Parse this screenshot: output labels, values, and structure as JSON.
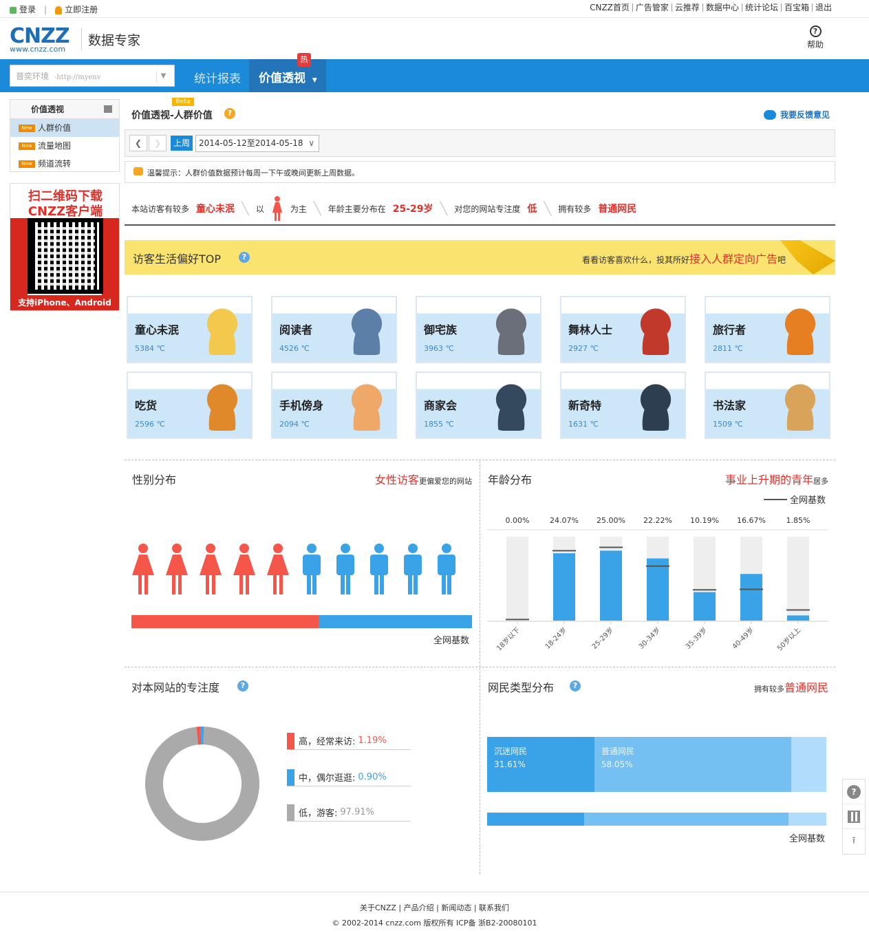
{
  "topbar": {
    "login": "登录",
    "register": "立即注册",
    "links": [
      "CNZZ首页",
      "广告管家",
      "云推荐",
      "数据中心",
      "统计论坛",
      "百宝箱",
      "退出"
    ]
  },
  "header": {
    "logo_main": "CNZZ",
    "logo_sub": "www.cnzz.com",
    "product": "数据专家",
    "help": "帮助"
  },
  "nav": {
    "site_name": "普奕环境",
    "site_url": "-http://myenv",
    "stats": "统计报表",
    "value": "价值透视",
    "hot": "热"
  },
  "sidebar": {
    "title": "价值透视",
    "new_tag": "New",
    "items": [
      "人群价值",
      "流量地图",
      "频道流转"
    ]
  },
  "qr": {
    "line1": "扫二维码下载",
    "line2": "CNZZ客户端",
    "support": "支持iPhone、Android"
  },
  "page": {
    "title": "价值透视-人群价值",
    "beta": "Beta",
    "feedback": "我要反馈意见"
  },
  "datebar": {
    "last_week": "上周",
    "range": "2014-05-12至2014-05-18"
  },
  "tip": "温馨提示：人群价值数据预计每周一下午或晚间更新上周数据。",
  "summary": {
    "p1": "本站访客有较多",
    "v1": "童心未泯",
    "p2": "以",
    "p3": "为主",
    "p4": "年龄主要分布在",
    "v4": "25-29岁",
    "p5": "对您的网站专注度",
    "v5": "低",
    "p6": "拥有较多",
    "v6": "普通网民"
  },
  "banner": {
    "title": "访客生活偏好TOP",
    "right_pre": "看看访客喜欢什么，投其所好",
    "right_link": "接入人群定向广告",
    "right_post": "吧"
  },
  "cards": [
    {
      "name": "童心未泯",
      "deg": "5384 ℃",
      "color": "#f2c94c"
    },
    {
      "name": "阅读者",
      "deg": "4526 ℃",
      "color": "#5b7fa6"
    },
    {
      "name": "御宅族",
      "deg": "3963 ℃",
      "color": "#6b6f7a"
    },
    {
      "name": "舞林人士",
      "deg": "2927 ℃",
      "color": "#c0392b"
    },
    {
      "name": "旅行者",
      "deg": "2811 ℃",
      "color": "#e67e22"
    },
    {
      "name": "吃货",
      "deg": "2596 ℃",
      "color": "#e0892b"
    },
    {
      "name": "手机傍身",
      "deg": "2094 ℃",
      "color": "#f0a868"
    },
    {
      "name": "商家会",
      "deg": "1855 ℃",
      "color": "#34495e"
    },
    {
      "name": "新奇特",
      "deg": "1631 ℃",
      "color": "#2c3e50"
    },
    {
      "name": "书法家",
      "deg": "1509 ℃",
      "color": "#d9a45a"
    }
  ],
  "gender": {
    "title": "性别分布",
    "note_red": "女性访客",
    "note_post": "更偏爱您的网站",
    "baseline": "全网基数",
    "female_share": 0.55,
    "colors": {
      "female": "#f4574a",
      "male": "#3aa2e6"
    }
  },
  "age": {
    "title": "年龄分布",
    "note_red": "事业上升期的青年",
    "note_post": "居多",
    "legend": "全网基数"
  },
  "chart_data": {
    "type": "bar",
    "categories": [
      "18岁以下",
      "18-24岁",
      "25-29岁",
      "30-34岁",
      "35-39岁",
      "40-49岁",
      "50岁以上"
    ],
    "values": [
      0.0,
      24.07,
      25.0,
      22.22,
      10.19,
      16.67,
      1.85
    ],
    "value_labels": [
      "0.00%",
      "24.07%",
      "25.00%",
      "22.22%",
      "10.19%",
      "16.67%",
      "1.85%"
    ],
    "baseline": [
      0.4,
      25.0,
      26.2,
      19.5,
      11.0,
      11.2,
      3.8
    ],
    "ylim": [
      0,
      30
    ]
  },
  "focus": {
    "title": "对本网站的专注度",
    "items": [
      {
        "label": "高，经常来访:",
        "value": "1.19%",
        "pct": 1.19,
        "color": "#f4574a"
      },
      {
        "label": "中，偶尔逛逛:",
        "value": "0.90%",
        "pct": 0.9,
        "color": "#3aa2e6"
      },
      {
        "label": "低，游客:",
        "value": "97.91%",
        "pct": 97.91,
        "color": "#aaaaaa"
      }
    ]
  },
  "nettype": {
    "title": "网民类型分布",
    "note_pre": "拥有较多",
    "note_red": "普通网民",
    "baseline": "全网基数",
    "segments": [
      {
        "label": "沉迷网民",
        "value": "31.61%",
        "pct": 31.61,
        "color": "#3aa2e6"
      },
      {
        "label": "普通网民",
        "value": "58.05%",
        "pct": 58.05,
        "color": "#74c0f2"
      },
      {
        "label": "",
        "value": "",
        "pct": 10.34,
        "color": "#b1dcfb"
      }
    ],
    "base_segments": [
      28.6,
      60.2,
      11.2
    ]
  },
  "footer": {
    "links": "关于CNZZ | 产品介绍 | 新闻动态 | 联系我们",
    "copyright": "© 2002-2014 cnzz.com 版权所有 ICP备 浙B2-20080101"
  }
}
